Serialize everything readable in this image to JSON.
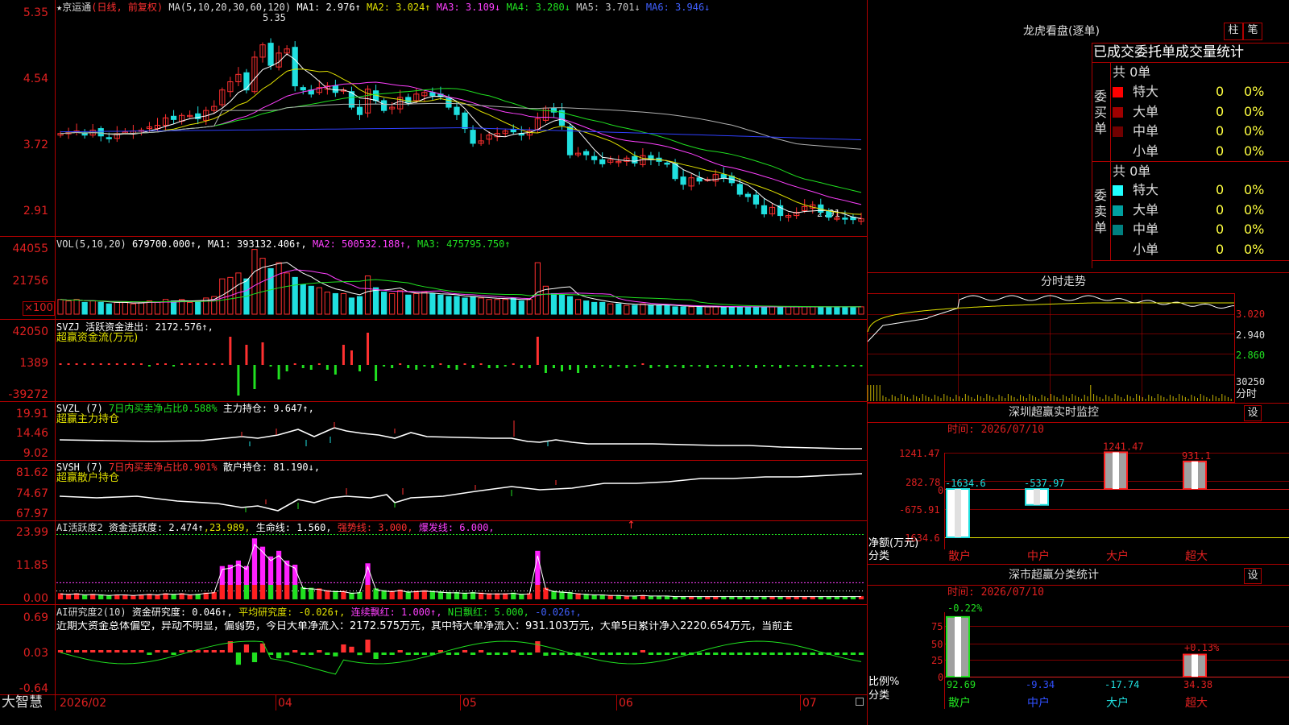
{
  "colors": {
    "up": "#ff3030",
    "down": "#20e0e0",
    "ma1": "#ffffff",
    "ma2": "#e0e000",
    "ma3": "#ff40ff",
    "ma4": "#20e020",
    "ma5": "#b0b0b0",
    "ma6": "#3040ff",
    "grid": "#b00000"
  },
  "kline": {
    "header_stock": "★京运通",
    "header_mode": "(日线, 前复权)",
    "header_ma": "MA(5,10,20,30,60,120)",
    "ma1": "MA1: 2.976↑",
    "ma2": "MA2: 3.024↑",
    "ma3": "MA3: 3.109↓",
    "ma4": "MA4: 3.280↓",
    "ma5": "MA5: 3.701↓",
    "ma6": "MA6: 3.946↓",
    "axis": [
      "5.35",
      "4.54",
      "3.72",
      "2.91"
    ],
    "high_label": "5.35",
    "low_label": "2.91",
    "closes": [
      4.02,
      4.03,
      4.05,
      4.0,
      4.06,
      3.99,
      3.96,
      4.02,
      4.04,
      4.05,
      4.06,
      4.1,
      4.12,
      4.21,
      4.19,
      4.24,
      4.24,
      4.2,
      4.3,
      4.35,
      4.55,
      4.65,
      4.74,
      4.55,
      4.95,
      5.1,
      4.85,
      5.0,
      5.05,
      4.6,
      4.55,
      4.5,
      4.58,
      4.6,
      4.52,
      4.55,
      4.34,
      4.25,
      4.56,
      4.42,
      4.3,
      4.34,
      4.46,
      4.4,
      4.5,
      4.52,
      4.48,
      4.47,
      4.34,
      4.25,
      4.08,
      3.9,
      3.93,
      4.0,
      4.02,
      4.05,
      4.04,
      4.0,
      4.05,
      4.2,
      4.33,
      4.28,
      4.12,
      3.76,
      3.78,
      3.76,
      3.7,
      3.65,
      3.7,
      3.68,
      3.72,
      3.66,
      3.75,
      3.7,
      3.68,
      3.65,
      3.47,
      3.4,
      3.48,
      3.44,
      3.46,
      3.52,
      3.48,
      3.42,
      3.28,
      3.25,
      3.16,
      3.04,
      3.12,
      3.02,
      3.02,
      3.06,
      3.13,
      3.15,
      3.06,
      3.0,
      2.99,
      2.98,
      2.97,
      2.98
    ]
  },
  "vol": {
    "header": "VOL(5,10,20)",
    "value": "679700.000↑,",
    "ma1": "MA1: 393132.406↑,",
    "ma2": "MA2: 500532.188↑,",
    "ma3": "MA3: 475795.750↑",
    "axis": [
      "44055",
      "21756",
      "×100"
    ],
    "values": [
      10,
      9,
      10,
      8,
      9,
      8,
      7,
      8,
      8,
      7,
      8,
      9,
      8,
      10,
      9,
      10,
      8,
      9,
      11,
      12,
      24,
      25,
      28,
      24,
      44,
      38,
      31,
      35,
      28,
      25,
      20,
      19,
      18,
      15,
      14,
      14,
      11,
      12,
      26,
      18,
      15,
      14,
      16,
      13,
      14,
      15,
      14,
      13,
      12,
      12,
      11,
      12,
      11,
      10,
      10,
      10,
      11,
      9,
      10,
      35,
      19,
      14,
      13,
      12,
      10,
      9,
      8,
      8,
      7,
      7,
      6,
      6,
      7,
      6,
      6,
      6,
      5,
      5,
      5,
      5,
      5,
      5,
      5,
      5,
      5,
      5,
      5,
      5,
      5,
      5,
      5,
      5,
      5,
      5,
      5,
      5,
      5,
      5,
      5,
      5
    ]
  },
  "svzj": {
    "header": "SVZJ  活跃资金进出: 2172.576↑,",
    "sub": "超赢资金流(万元)",
    "axis": [
      "42050",
      "1389",
      "-39272"
    ],
    "values": [
      2,
      2,
      2,
      2,
      2,
      2,
      2,
      2,
      2,
      2,
      2,
      -2,
      2,
      2,
      -2,
      2,
      2,
      2,
      2,
      2,
      2,
      35,
      -38,
      25,
      -30,
      28,
      -2,
      -18,
      -8,
      2,
      -4,
      -6,
      2,
      -6,
      -12,
      25,
      18,
      -8,
      40,
      -20,
      -2,
      -4,
      2,
      -4,
      -6,
      -2,
      -4,
      2,
      -4,
      -6,
      2,
      -4,
      2,
      -4,
      -4,
      -2,
      2,
      -4,
      -4,
      35,
      -10,
      -4,
      -8,
      -6,
      -10,
      -4,
      -4,
      -2,
      -4,
      -2,
      -4,
      -2,
      2,
      -4,
      -2,
      -4,
      -2,
      -4,
      -2,
      -2,
      -4,
      -2,
      -2,
      -4,
      -2,
      -2,
      -4,
      -2,
      -2,
      -4,
      -2,
      -2,
      -2,
      -4,
      -2,
      -2,
      -2,
      -2,
      -2,
      -2
    ]
  },
  "svzl": {
    "header_a": "SVZL (7)",
    "header_b": "7日内买卖净占比0.588%",
    "header_c": "主力持仓: 9.647↑,",
    "sub": "超赢主力持仓",
    "axis": [
      "19.91",
      "14.46",
      "9.02"
    ]
  },
  "svsh": {
    "header_a": "SVSH (7)",
    "header_b": "7日内买卖净占比0.901%",
    "header_c": "散户持仓: 81.190↓,",
    "sub": "超赢散户持仓",
    "axis": [
      "81.62",
      "74.67",
      "67.97"
    ]
  },
  "ai_active": {
    "header_a": "AI活跃度2",
    "header_b": "资金活跃度: 2.474↑",
    "header_c": ",23.989,",
    "header_d": "生命线: 1.560,",
    "header_e": "强势线: 3.000,",
    "header_f": "爆发线: 6.000,",
    "arrow": "↑",
    "axis": [
      "23.99",
      "11.85",
      "0.00"
    ]
  },
  "ai_research": {
    "header_a": "AI研究度2(10)",
    "header_b": "资金研究度: 0.046↑,",
    "header_c": "平均研究度: -0.026↑,",
    "header_d": "连续飘红: 1.000↑,",
    "header_e": "N日飘红: 5.000,",
    "header_f": "-0.026↑,",
    "note": "近期大资金总体偏空，异动不明显，偏弱势，今日大单净流入：2172.575万元，其中特大单净流入：931.103万元，大单5日累计净入2220.654万元，当前主",
    "axis": [
      "0.69",
      "0.03",
      "-0.64"
    ]
  },
  "footer": {
    "brand": "大智慧",
    "months": [
      "2026/02",
      "04",
      "05",
      "06",
      "07"
    ]
  },
  "lhb": {
    "title": "龙虎看盘(逐单)",
    "btn1": "柱",
    "btn2": "笔",
    "tabs": "已成交委托单成交量统计",
    "buy_label": "委买单",
    "sell_label": "委卖单",
    "buy_total": "共 0单",
    "sell_total": "共 0单",
    "rows": [
      {
        "name": "特大",
        "count": "0",
        "pct": "0%"
      },
      {
        "name": "大单",
        "count": "0",
        "pct": "0%"
      },
      {
        "name": "中单",
        "count": "0",
        "pct": "0%"
      },
      {
        "name": "小单",
        "count": "0",
        "pct": "0%"
      }
    ],
    "buy_colors": [
      "#ff0000",
      "#a00000",
      "#700000",
      ""
    ],
    "sell_colors": [
      "#20ffff",
      "#00a0a0",
      "#008080",
      ""
    ]
  },
  "intraday": {
    "title": "分时走势",
    "axis": [
      "3.020",
      "2.940",
      "2.860",
      "30250"
    ],
    "vol_label": "分时"
  },
  "sz_monitor": {
    "title": "深圳超赢实时监控",
    "btn": "设",
    "time": "时间: 2026/07/10",
    "axis": [
      "1241.47",
      "282.78",
      "0",
      "-675.91",
      "-1634.6"
    ],
    "values": [
      -1634.6,
      -537.97,
      1241.47,
      931.1
    ],
    "labels": [
      "-1634.6",
      "-537.97",
      "1241.47",
      "931.1"
    ],
    "ylabel1": "净额(万元)",
    "ylabel2": "分类",
    "cats": [
      "散户",
      "中户",
      "大户",
      "超大"
    ]
  },
  "sz_stats": {
    "title": "深市超赢分类统计",
    "btn": "设",
    "time": "时间: 2026/07/10",
    "axis": [
      "75",
      "50",
      "25",
      "0"
    ],
    "top_left": "-0.22%",
    "top_right": "+0.13%",
    "ylabel1": "比例%",
    "ylabel2": "分类",
    "values": [
      "92.69",
      "-9.34",
      "-17.74",
      "34.38"
    ],
    "cats": [
      "散户",
      "中户",
      "大户",
      "超大"
    ]
  }
}
